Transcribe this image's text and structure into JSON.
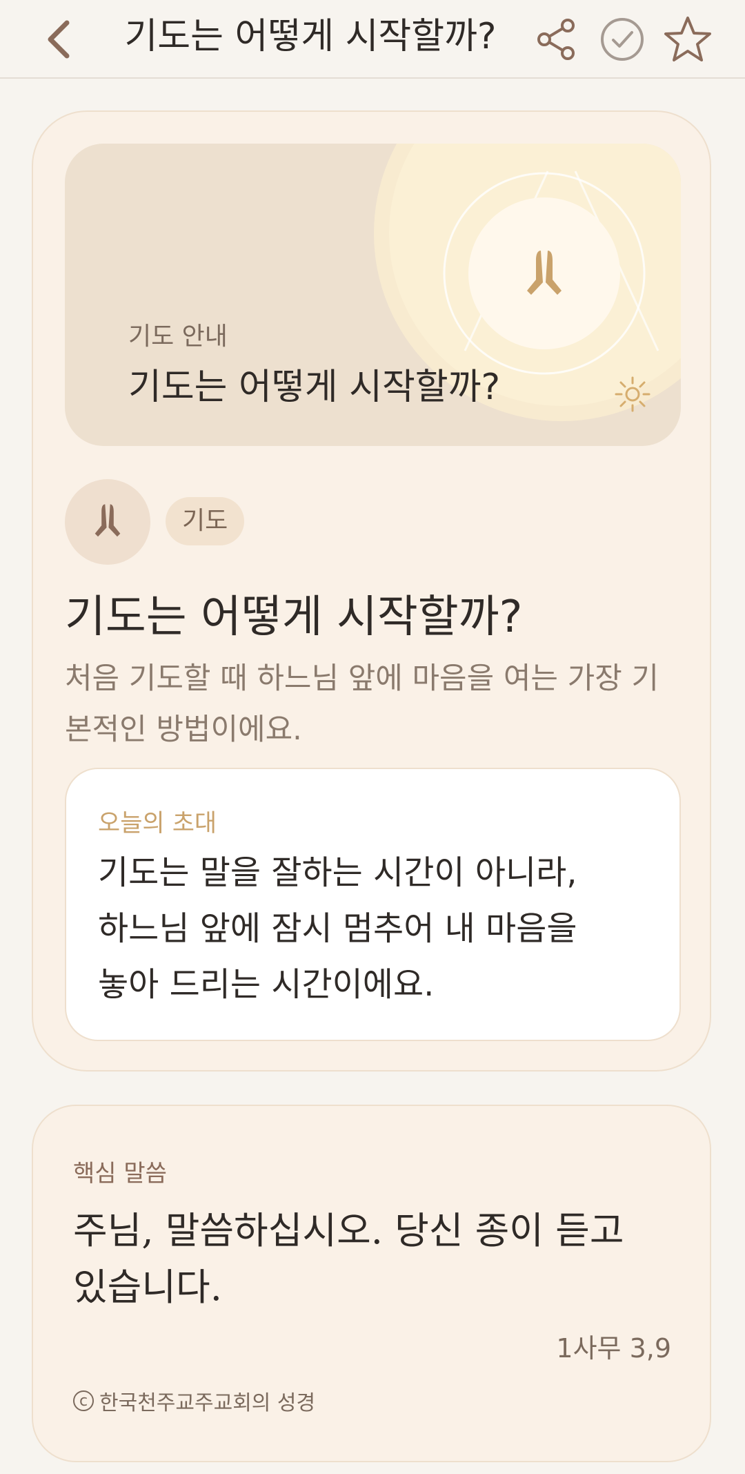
{
  "header": {
    "title": "기도는 어떻게 시작할까?",
    "back_icon": "chevron-left-icon",
    "share_icon": "share-icon",
    "check_icon": "check-circle-icon",
    "star_icon": "star-outline-icon"
  },
  "hero": {
    "eyebrow": "기도 안내",
    "title": "기도는 어떻게 시작할까?",
    "icon": "praying-hands-icon",
    "accent_icon": "sun-icon"
  },
  "article": {
    "avatar_icon": "praying-hands-icon",
    "tag": "기도",
    "title": "기도는 어떻게 시작할까?",
    "description": "처음 기도할 때 하느님 앞에 마음을 여는 가장 기본적인 방법이에요."
  },
  "invite": {
    "label": "오늘의 초대",
    "text": "기도는 말을 잘하는 시간이 아니라,\n하느님 앞에 잠시 멈추어 내 마음을\n놓아 드리는 시간이에요."
  },
  "verse": {
    "label": "핵심 말씀",
    "text": "주님, 말씀하십시오. 당신 종이 듣고 있습니다.",
    "reference": "1사무 3,9",
    "copyright_symbol": "c",
    "copyright": "한국천주교주교회의 성경"
  },
  "colors": {
    "background": "#f7f4ef",
    "card": "#faf1e7",
    "accent_gold": "#c9a26b",
    "icon_brown": "#8a6b5a"
  }
}
